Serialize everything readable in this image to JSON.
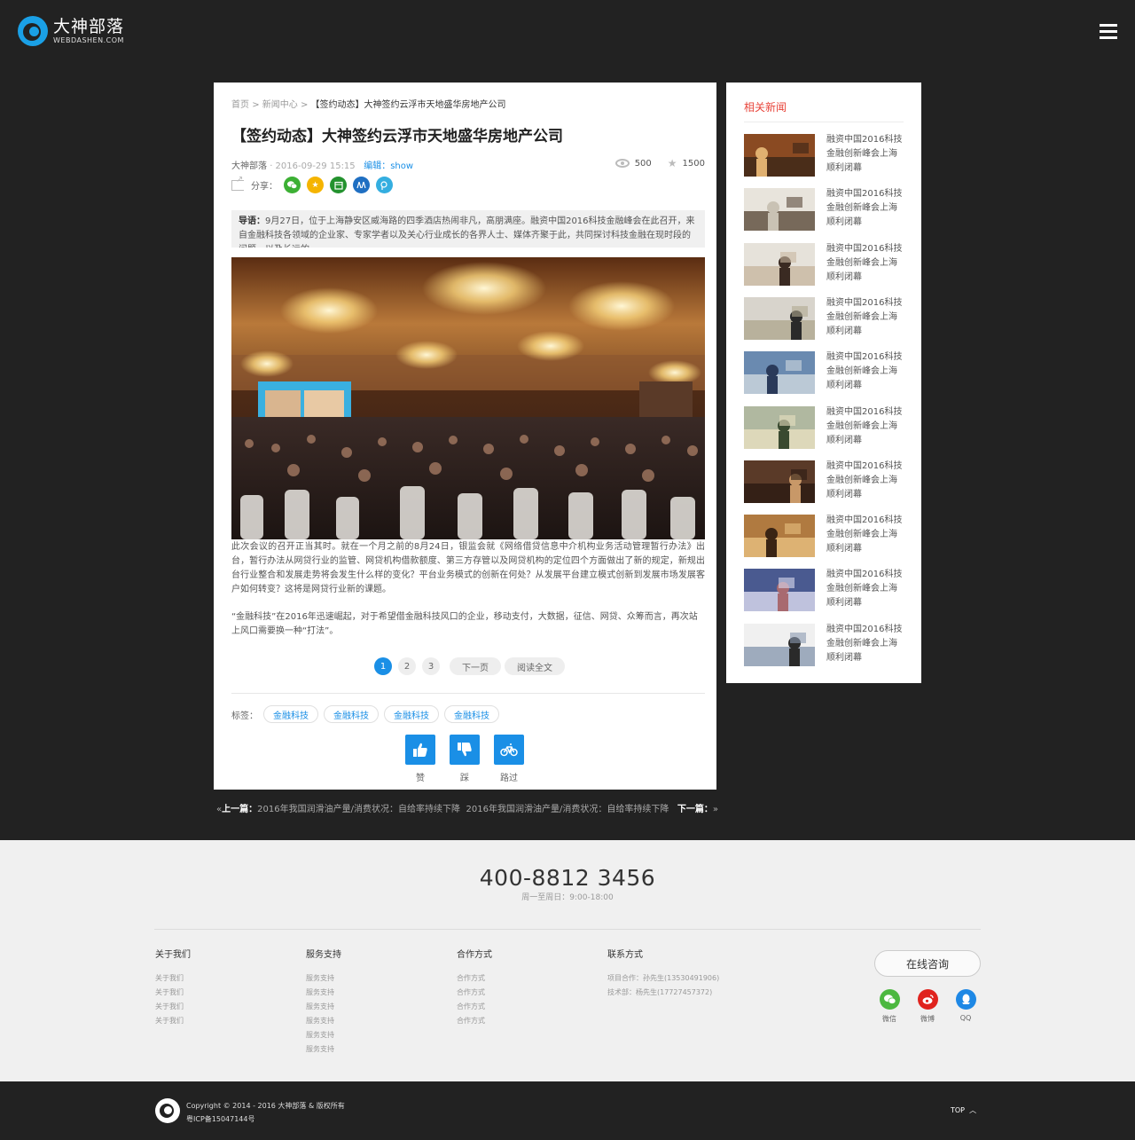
{
  "header": {
    "logo_cn": "大神部落",
    "logo_en": "WEBDASHEN.COM"
  },
  "article": {
    "breadcrumb": [
      "首页",
      "新闻中心",
      "【签约动态】大神签约云浮市天地盛华房地产公司"
    ],
    "breadcrumb_sep": ">",
    "title": "【签约动态】大神签约云浮市天地盛华房地产公司",
    "author": "大神部落",
    "date": "· 2016-09-29 15:15",
    "editor": "编辑：show",
    "views": "500",
    "favorites": "1500",
    "share_label": "分享：",
    "share_buttons": [
      {
        "icon": "wechat-icon",
        "color": "#3cb034"
      },
      {
        "icon": "star-icon",
        "color": "#f5b400"
      },
      {
        "icon": "calendar-icon",
        "color": "#23922e"
      },
      {
        "icon": "renren-icon",
        "color": "#1f6fc2"
      },
      {
        "icon": "pinyou-icon",
        "color": "#34aee0"
      }
    ],
    "intro_label": "导语：",
    "intro_text": "9月27日，位于上海静安区威海路的四季酒店热闹非凡，高朋满座。融资中国2016科技金融峰会在此召开，来自金融科技各领域的企业家、专家学者以及关心行业成长的各界人士、媒体齐聚于此，共同探讨科技金融在现时段的问题，以及长远的",
    "paragraph1": "此次会议的召开正当其时。就在一个月之前的8月24日，银监会就《网络借贷信息中介机构业务活动管理暂行办法》出台，暂行办法从网贷行业的监管、网贷机构借款额度、第三方存管以及网贷机构的定位四个方面做出了新的规定，新规出台行业整合和发展走势将会发生什么样的变化？平台业务模式的创新在何处？从发展平台建立模式创新到发展市场发展客户如何转变？这将是网贷行业新的课题。",
    "paragraph2": "“金融科技”在2016年迅速崛起，对于希望借金融科技风口的企业，移动支付，大数据，征信、网贷、众筹而言，再次站上风口需要换一种“打法”。",
    "pages": [
      "1",
      "2",
      "3"
    ],
    "next_page": "下一页",
    "read_all": "阅读全文",
    "tags_label": "标签：",
    "tags": [
      "金融科技",
      "金融科技",
      "金融科技",
      "金融科技"
    ],
    "votes": [
      {
        "label": "赞",
        "icon": "thumbs-up-icon"
      },
      {
        "label": "踩",
        "icon": "thumbs-down-icon"
      },
      {
        "label": "路过",
        "icon": "bicycle-icon"
      }
    ]
  },
  "prevnext": {
    "prev_label": "上一篇：",
    "prev_title": "2016年我国润滑油产量/消费状况：自给率持续下降",
    "next_label": "下一篇：",
    "next_title": "2016年我国润滑油产量/消费状况：自给率持续下降"
  },
  "sidebar": {
    "title": "相关新闻",
    "items": [
      {
        "text": "融资中国2016科技金融创新峰会上海顺利闭幕"
      },
      {
        "text": "融资中国2016科技金融创新峰会上海顺利闭幕"
      },
      {
        "text": "融资中国2016科技金融创新峰会上海顺利闭幕"
      },
      {
        "text": "融资中国2016科技金融创新峰会上海顺利闭幕"
      },
      {
        "text": "融资中国2016科技金融创新峰会上海顺利闭幕"
      },
      {
        "text": "融资中国2016科技金融创新峰会上海顺利闭幕"
      },
      {
        "text": "融资中国2016科技金融创新峰会上海顺利闭幕"
      },
      {
        "text": "融资中国2016科技金融创新峰会上海顺利闭幕"
      },
      {
        "text": "融资中国2016科技金融创新峰会上海顺利闭幕"
      },
      {
        "text": "融资中国2016科技金融创新峰会上海顺利闭幕"
      }
    ]
  },
  "footer": {
    "phone": "400-8812 3456",
    "hours": "周一至周日：9:00-18:00",
    "col_about": {
      "title": "关于我们",
      "links": [
        "关于我们",
        "关于我们",
        "关于我们",
        "关于我们"
      ]
    },
    "col_service": {
      "title": "服务支持",
      "links": [
        "服务支持",
        "服务支持",
        "服务支持",
        "服务支持",
        "服务支持",
        "服务支持"
      ]
    },
    "col_coop": {
      "title": "合作方式",
      "links": [
        "合作方式",
        "合作方式",
        "合作方式",
        "合作方式"
      ]
    },
    "col_contact": {
      "title": "联系方式",
      "lines": [
        "项目合作：孙先生(13530491906)",
        "技术部：杨先生(17727457372)"
      ]
    },
    "consult": "在线咨询",
    "social": [
      {
        "label": "微信",
        "icon": "wechat-icon",
        "color": "#4cb840"
      },
      {
        "label": "微博",
        "icon": "weibo-icon",
        "color": "#e0231e"
      },
      {
        "label": "QQ",
        "icon": "qq-icon",
        "color": "#1e88e5"
      }
    ],
    "copyright": "Copyright © 2014 - 2016 大神部落 & 版权所有",
    "icp": "粤ICP备15047144号",
    "top": "TOP"
  }
}
